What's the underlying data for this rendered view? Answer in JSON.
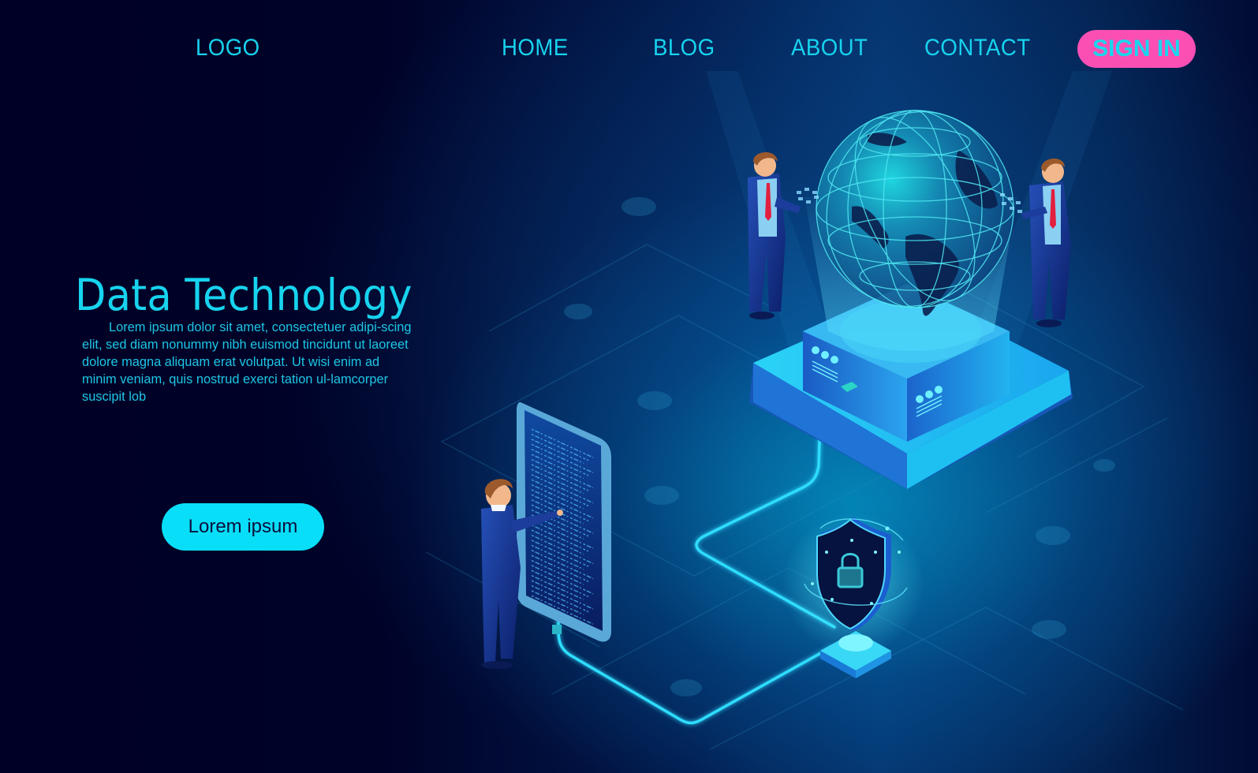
{
  "nav": {
    "logo": "LOGO",
    "links": [
      {
        "label": "HOME"
      },
      {
        "label": "BLOG"
      },
      {
        "label": "ABOUT"
      },
      {
        "label": "CONTACT"
      }
    ],
    "signin_label": "SIGN IN"
  },
  "hero": {
    "title": "Data Technology",
    "body": "Lorem ipsum dolor sit amet, consectetuer adipi-scing elit, sed diam nonummy nibh euismod tincidunt ut laoreet dolore magna aliquam erat volutpat. Ut wisi enim ad minim veniam, quis nostrud exerci tation ul-lamcorper suscipit lob",
    "cta_label": "Lorem ipsum"
  },
  "illustration": {
    "elements": [
      "globe-hologram",
      "server-platform",
      "smartphone",
      "security-shield",
      "businessman-left",
      "businessman-right",
      "businessman-phone",
      "data-cable"
    ]
  },
  "colors": {
    "background": "#000026",
    "accent": "#17d3ee",
    "signin_bg": "#fb4fb4",
    "cta_bg": "#08def7",
    "cta_text": "#0b0f3d"
  }
}
